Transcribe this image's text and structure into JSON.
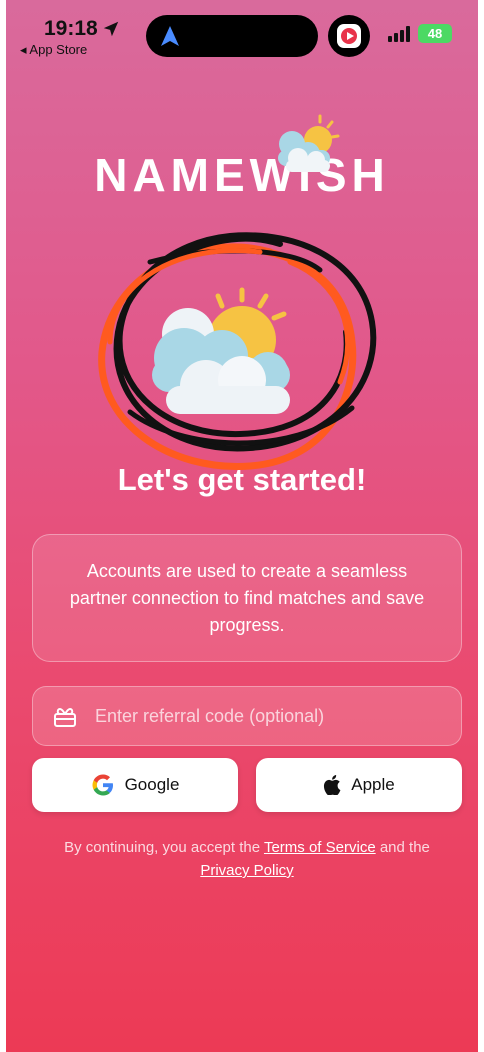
{
  "status_bar": {
    "time": "19:18",
    "back_label": "◂ App Store",
    "battery": "48"
  },
  "app": {
    "logo_text": "NAMEWISH",
    "heading": "Let's get started!",
    "info_text": "Accounts are used to create a seamless partner connection to find matches and save progress."
  },
  "referral": {
    "placeholder": "Enter referral code (optional)",
    "value": ""
  },
  "buttons": {
    "google_label": "Google",
    "apple_label": "Apple"
  },
  "terms": {
    "prefix": "By continuing, you accept the ",
    "tos_label": "Terms of Service",
    "middle": " and the",
    "privacy_label": "Privacy Policy"
  },
  "colors": {
    "gradient_top": "#d96a9c",
    "gradient_bottom": "#ec3a55",
    "scribble_black": "#111111",
    "scribble_orange": "#ff5a1f",
    "sun": "#f6c343",
    "cloud_blue": "#a9d7e6"
  },
  "icons": {
    "location": "location-arrow-icon",
    "navigation": "navigation-arrow-icon",
    "youtube": "youtube-icon",
    "signal": "signal-icon",
    "battery": "battery-icon",
    "gift": "gift-icon",
    "google": "google-g-icon",
    "apple": "apple-icon",
    "weather": "sun-cloud-icon"
  }
}
